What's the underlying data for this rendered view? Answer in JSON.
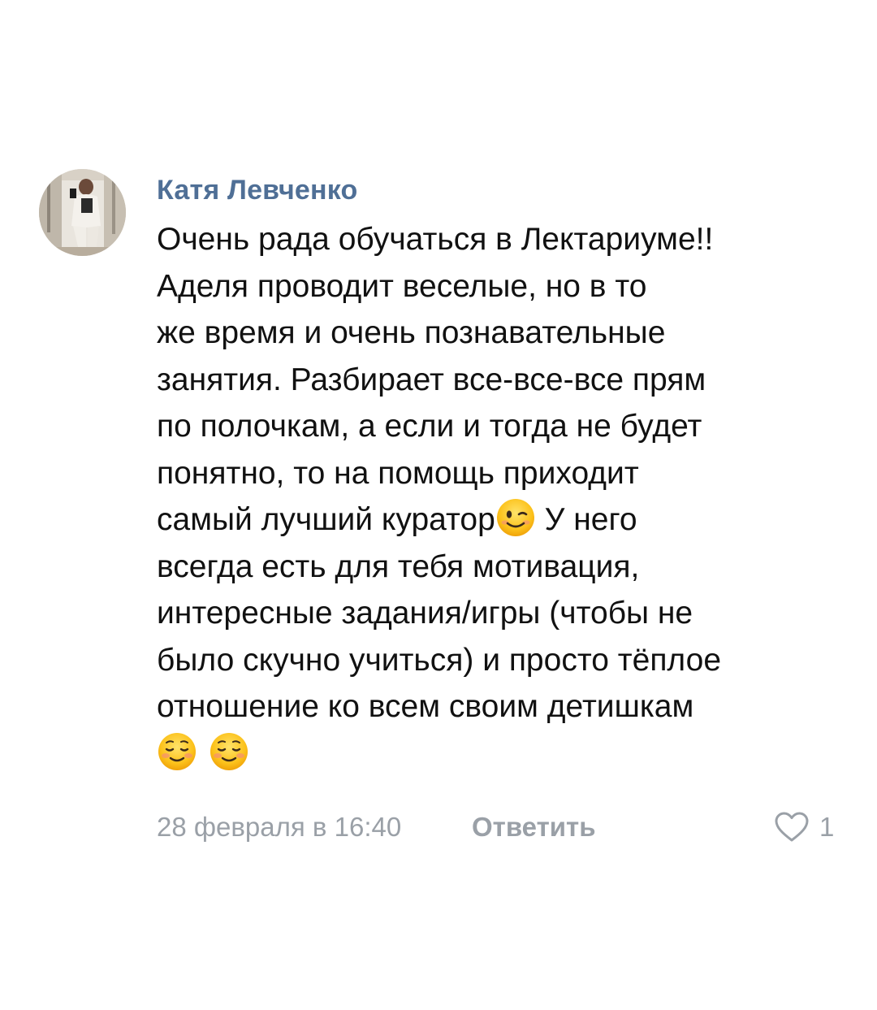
{
  "comment": {
    "author": "Катя Левченко",
    "text_lines": [
      "Очень рада обучаться в Лектариуме!!",
      "Аделя проводит веселые, но в то",
      "же время и очень познавательные",
      "занятия. Разбирает все-все-все прям",
      "по полочкам, а если и тогда не будет",
      "понятно, то на помощь приходит",
      "самый лучший куратор",
      " У него",
      "всегда есть для тебя мотивация,",
      "интересные задания/игры (чтобы не",
      "было скучно учиться) и просто тёплое",
      "отношение ко всем своим детишкам"
    ],
    "emojis": {
      "inline": "winking-face",
      "final": [
        "smiling-face",
        "smiling-face"
      ]
    },
    "date": "28 февраля в 16:40",
    "reply_label": "Ответить",
    "likes_count": "1"
  },
  "colors": {
    "author": "#4f6f96",
    "text": "#111111",
    "meta": "#9aa0a7",
    "background": "#ffffff"
  }
}
